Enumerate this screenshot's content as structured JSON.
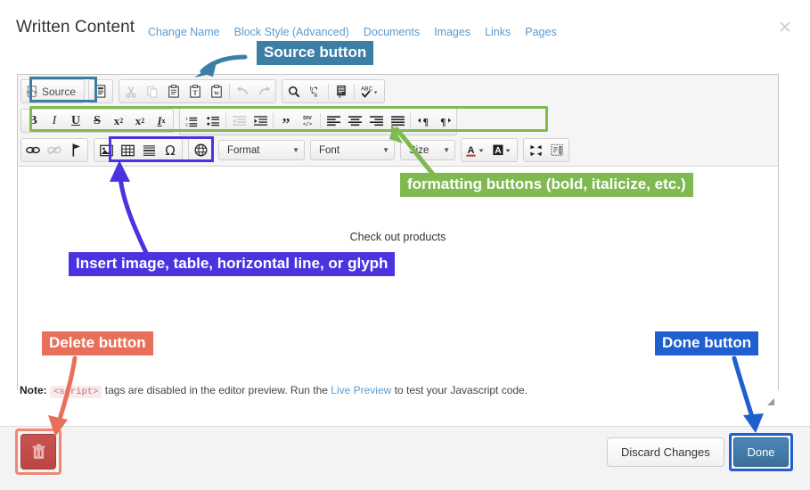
{
  "header": {
    "title": "Written Content",
    "nav": [
      {
        "label": "Change Name"
      },
      {
        "label": "Block Style (Advanced)"
      },
      {
        "label": "Documents"
      },
      {
        "label": "Images"
      },
      {
        "label": "Links"
      },
      {
        "label": "Pages"
      }
    ],
    "close_glyph": "✕"
  },
  "toolbar": {
    "row1": {
      "source_label": "Source",
      "icons": [
        "source-icon",
        "templates-icon",
        "cut-icon",
        "copy-icon",
        "paste-icon",
        "paste-text-icon",
        "paste-word-icon",
        "undo-icon",
        "redo-icon",
        "find-icon",
        "replace-icon",
        "select-all-icon",
        "spellcheck-icon"
      ]
    },
    "row2": {
      "icons": [
        "bold-icon",
        "italic-icon",
        "underline-icon",
        "strikethrough-icon",
        "subscript-icon",
        "superscript-icon",
        "remove-format-icon",
        "numbered-list-icon",
        "bulleted-list-icon",
        "decrease-indent-icon",
        "increase-indent-icon",
        "blockquote-icon",
        "div-container-icon",
        "align-left-icon",
        "align-center-icon",
        "align-right-icon",
        "justify-icon",
        "ltr-icon",
        "rtl-icon"
      ],
      "bold_label": "B",
      "italic_label": "I",
      "underline_label": "U",
      "strike_label": "S",
      "sub_label": "x",
      "sub_sup": "2",
      "sup_label": "x",
      "sup_sup": "2",
      "removeformat_label": "I",
      "removeformat_sub": "x",
      "quote_label": "”",
      "div_label": "DIV"
    },
    "row3": {
      "icons": [
        "link-icon",
        "unlink-icon",
        "anchor-icon",
        "image-icon",
        "table-icon",
        "horizontal-rule-icon",
        "special-char-icon",
        "iframe-icon",
        "text-color-icon",
        "bg-color-icon",
        "maximize-icon",
        "show-blocks-icon"
      ],
      "omega_label": "Ω",
      "textcolor_label": "A",
      "bgcolor_label": "A",
      "format_value": "Format",
      "font_value": "Font",
      "size_value": "Size",
      "caret": "▼"
    }
  },
  "content": {
    "text": "Check out products"
  },
  "note": {
    "prefix": "Note:",
    "code": "<script>",
    "middle": "tags are disabled in the editor preview. Run the",
    "link": "Live Preview",
    "suffix": "to test your Javascript code."
  },
  "footer": {
    "delete_icon": "trash-icon",
    "discard_label": "Discard Changes",
    "done_label": "Done"
  },
  "annotations": [
    {
      "name": "source-button-callout",
      "text": "Source button",
      "color": "#3c7fa6"
    },
    {
      "name": "formatting-buttons-callout",
      "text": "formatting buttons (bold, italicize, etc.)",
      "color": "#7fb950"
    },
    {
      "name": "insert-callout",
      "text": "Insert image, table, horizontal line, or glyph",
      "color": "#4b33e0"
    },
    {
      "name": "delete-button-callout",
      "text": "Delete button",
      "color": "#e8705b"
    },
    {
      "name": "done-button-callout",
      "text": "Done button",
      "color": "#1f5fd0"
    }
  ],
  "colors": {
    "source_blue": "#3c7fa6",
    "formatting_green": "#7fb950",
    "insert_purple": "#4b33e0",
    "delete_salmon": "#e8705b",
    "done_blue": "#1f5fd0",
    "link_blue": "#5b9bd1"
  }
}
